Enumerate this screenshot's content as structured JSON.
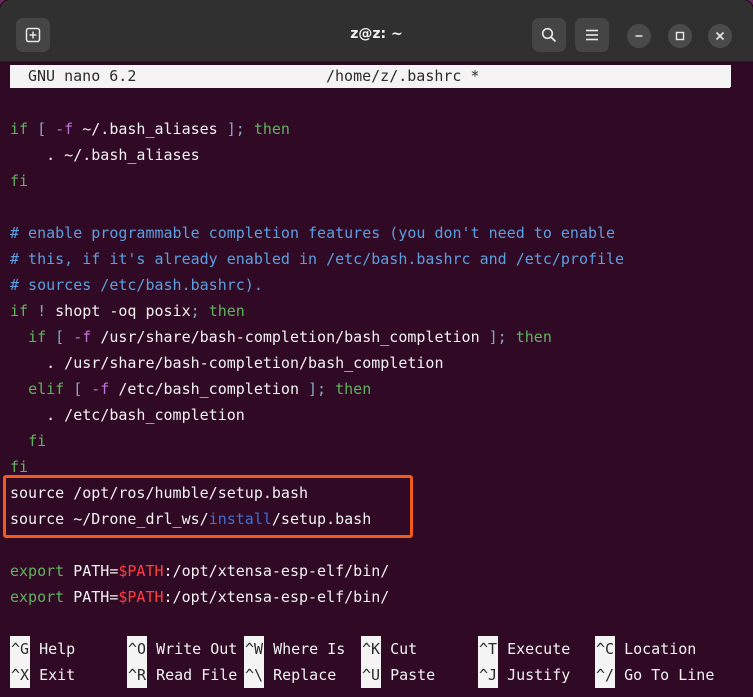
{
  "window": {
    "title": "z@z: ~"
  },
  "nano": {
    "version": "GNU nano 6.2",
    "file": "/home/z/.bashrc *"
  },
  "code": {
    "l1": [
      "if",
      "[",
      "-f",
      "~/.bash_aliases",
      "];",
      "then"
    ],
    "l2": ". ~/.bash_aliases",
    "l3": "fi",
    "c1": "# enable programmable completion features (you don't need to enable",
    "c2": "# this, if it's already enabled in /etc/bash.bashrc and /etc/profile",
    "c3": "# sources /etc/bash.bashrc).",
    "l7": [
      "if",
      "!",
      "shopt -oq posix",
      ";",
      "then"
    ],
    "l8": [
      "if",
      "[",
      "-f",
      "/usr/share/bash-completion/bash_completion",
      "];",
      "then"
    ],
    "l9": ". /usr/share/bash-completion/bash_completion",
    "l10": [
      "elif",
      "[",
      "-f",
      "/etc/bash_completion",
      "];",
      "then"
    ],
    "l11": ". /etc/bash_completion",
    "l12": "fi",
    "l13": "fi",
    "src1": "source /opt/ros/humble/setup.bash",
    "src2a": "source ~/Drone_drl_ws/",
    "src2b": "install",
    "src2c": "/setup.bash",
    "exp_kw": "export",
    "exp_a": "PATH=",
    "exp_var": "$PATH",
    "exp_b": ":/opt/xtensa-esp-elf/bin/"
  },
  "shortcuts": [
    {
      "key": "^G",
      "label": "Help"
    },
    {
      "key": "^O",
      "label": "Write Out"
    },
    {
      "key": "^W",
      "label": "Where Is"
    },
    {
      "key": "^K",
      "label": "Cut"
    },
    {
      "key": "^T",
      "label": "Execute"
    },
    {
      "key": "^C",
      "label": "Location"
    },
    {
      "key": "^X",
      "label": "Exit"
    },
    {
      "key": "^R",
      "label": "Read File"
    },
    {
      "key": "^\\",
      "label": "Replace"
    },
    {
      "key": "^U",
      "label": "Paste"
    },
    {
      "key": "^J",
      "label": "Justify"
    },
    {
      "key": "^/",
      "label": "Go To Line"
    }
  ],
  "colors": {
    "background": "#300a24",
    "keyword": "#5fb35f",
    "comment": "#5c9fe0",
    "variable": "#ff3f3f",
    "highlight_border": "#f05b1b"
  }
}
